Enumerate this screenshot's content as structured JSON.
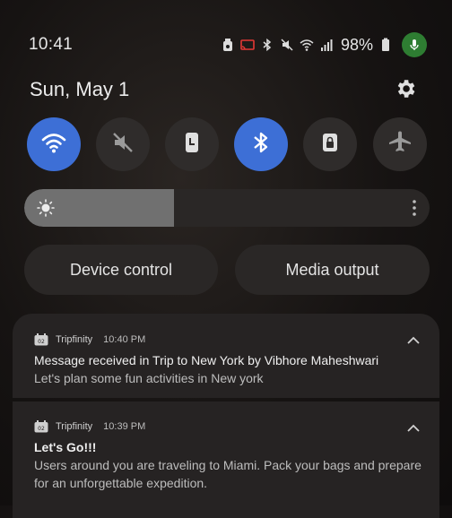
{
  "status_bar": {
    "time": "10:41",
    "battery_percent": "98%",
    "icons": [
      "alarm-icon",
      "cast-icon",
      "bluetooth-icon",
      "mute-icon",
      "wifi-icon",
      "signal-icon",
      "battery-icon",
      "mic-icon"
    ]
  },
  "header": {
    "date": "Sun, May 1",
    "settings_icon": "gear-icon"
  },
  "quick_tiles": [
    {
      "name": "wifi",
      "icon": "wifi-icon",
      "on": true
    },
    {
      "name": "sound",
      "icon": "mute-icon",
      "on": false
    },
    {
      "name": "portrait",
      "icon": "portrait-lock-icon",
      "on": false
    },
    {
      "name": "bluetooth",
      "icon": "bluetooth-icon",
      "on": true
    },
    {
      "name": "lock",
      "icon": "lock-icon",
      "on": false
    },
    {
      "name": "airplane",
      "icon": "airplane-icon",
      "on": false
    }
  ],
  "brightness": {
    "level_fraction": 0.37
  },
  "buttons": {
    "device_control": "Device control",
    "media_output": "Media output"
  },
  "notifications": [
    {
      "app": "Tripfinity",
      "time": "10:40 PM",
      "title": "Message received in Trip to New York by Vibhore Maheshwari",
      "body": "Let's plan some fun activities in New york"
    },
    {
      "app": "Tripfinity",
      "time": "10:39 PM",
      "title": "Let's Go!!!",
      "body": "Users around you are traveling to Miami. Pack your bags and prepare for an unforgettable expedition."
    }
  ],
  "colors": {
    "accent": "#3d6fd6",
    "mic": "#2e7d32"
  }
}
